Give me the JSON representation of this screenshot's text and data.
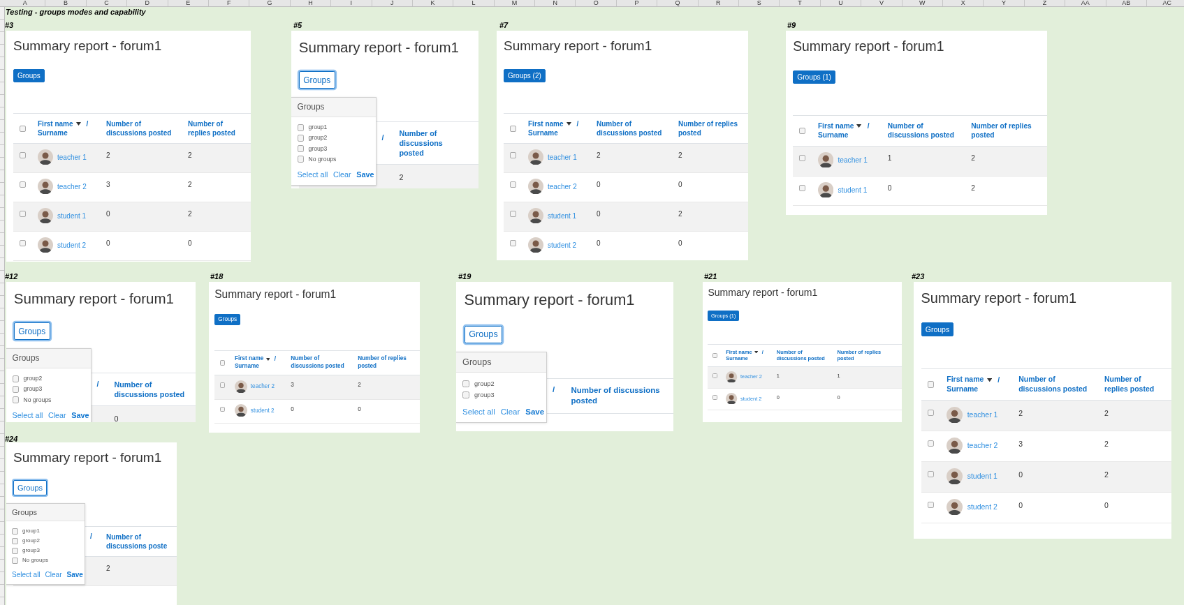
{
  "spreadsheet": {
    "column_headers": [
      "A",
      "B",
      "C",
      "D",
      "E",
      "F",
      "G",
      "H",
      "I",
      "J",
      "K",
      "L",
      "M",
      "N",
      "O",
      "P",
      "Q",
      "R",
      "S",
      "T",
      "U",
      "V",
      "W",
      "X",
      "Y",
      "Z",
      "AA",
      "AB",
      "AC"
    ],
    "title": "Testing - groups modes and capability",
    "screenshots": [
      {
        "label": "#3",
        "title": "Summary report - forum1",
        "groups_button": {
          "label": "Groups",
          "expanded": false
        },
        "table": {
          "header_checkbox": {
            "checked": false
          },
          "name_header": {
            "first": "First name",
            "separator": "/",
            "last": "Surname"
          },
          "columns": [
            "Number of discussions posted",
            "Number of replies posted"
          ],
          "rows": [
            {
              "name": "teacher 1",
              "checked": false,
              "values": [
                "2",
                "2"
              ]
            },
            {
              "name": "teacher 2",
              "checked": false,
              "values": [
                "3",
                "2"
              ]
            },
            {
              "name": "student 1",
              "checked": false,
              "values": [
                "0",
                "2"
              ]
            },
            {
              "name": "student 2",
              "checked": false,
              "values": [
                "0",
                "0"
              ]
            }
          ]
        }
      },
      {
        "label": "#5",
        "title": "Summary report - forum1",
        "groups_button": {
          "label": "Groups",
          "expanded": true
        },
        "dropdown": {
          "title": "Groups",
          "options": [
            {
              "label": "group1",
              "checked": false
            },
            {
              "label": "group2",
              "checked": false
            },
            {
              "label": "group3",
              "checked": false
            },
            {
              "label": "No groups",
              "checked": false
            }
          ],
          "actions": [
            "Select all",
            "Clear",
            "Save"
          ]
        },
        "table": {
          "name_header": {
            "separator": "/"
          },
          "columns": [
            "Number of discussions posted"
          ],
          "rows": [
            {
              "values": [
                "2"
              ]
            }
          ]
        }
      },
      {
        "label": "#7",
        "title": "Summary report - forum1",
        "groups_button": {
          "label": "Groups (2)",
          "expanded": false
        },
        "table": {
          "header_checkbox": {
            "checked": false
          },
          "name_header": {
            "first": "First name",
            "separator": "/",
            "last": "Surname"
          },
          "columns": [
            "Number of discussions posted",
            "Number of replies posted"
          ],
          "rows": [
            {
              "name": "teacher 1",
              "checked": false,
              "values": [
                "2",
                "2"
              ]
            },
            {
              "name": "teacher 2",
              "checked": false,
              "values": [
                "0",
                "0"
              ]
            },
            {
              "name": "student 1",
              "checked": false,
              "values": [
                "0",
                "2"
              ]
            },
            {
              "name": "student 2",
              "checked": false,
              "values": [
                "0",
                "0"
              ]
            }
          ]
        }
      },
      {
        "label": "#9",
        "title": "Summary report - forum1",
        "groups_button": {
          "label": "Groups (1)",
          "expanded": false
        },
        "table": {
          "header_checkbox": {
            "checked": false
          },
          "name_header": {
            "first": "First name",
            "separator": "/",
            "last": "Surname"
          },
          "columns": [
            "Number of discussions posted",
            "Number of replies posted"
          ],
          "rows": [
            {
              "name": "teacher 1",
              "checked": false,
              "values": [
                "1",
                "2"
              ]
            },
            {
              "name": "student 1",
              "checked": false,
              "values": [
                "0",
                "2"
              ]
            }
          ]
        }
      },
      {
        "label": "#12",
        "title": "Summary report - forum1",
        "groups_button": {
          "label": "Groups",
          "expanded": true
        },
        "dropdown": {
          "title": "Groups",
          "options": [
            {
              "label": "group2",
              "checked": false
            },
            {
              "label": "group3",
              "checked": false
            },
            {
              "label": "No groups",
              "checked": false
            }
          ],
          "actions": [
            "Select all",
            "Clear",
            "Save"
          ]
        },
        "table": {
          "name_header": {
            "separator": "/"
          },
          "columns": [
            "Number of discussions posted"
          ],
          "rows": [
            {
              "values": [
                "0"
              ]
            }
          ]
        }
      },
      {
        "label": "#18",
        "title": "Summary report - forum1",
        "groups_button": {
          "label": "Groups",
          "expanded": false
        },
        "table": {
          "header_checkbox": {
            "checked": false
          },
          "name_header": {
            "first": "First name",
            "separator": "/",
            "last": "Surname"
          },
          "columns": [
            "Number of discussions posted",
            "Number of replies posted"
          ],
          "rows": [
            {
              "name": "teacher 2",
              "checked": false,
              "values": [
                "3",
                "2"
              ]
            },
            {
              "name": "student 2",
              "checked": false,
              "values": [
                "0",
                "0"
              ]
            }
          ]
        }
      },
      {
        "label": "#19",
        "title": "Summary report - forum1",
        "groups_button": {
          "label": "Groups",
          "expanded": true
        },
        "dropdown": {
          "title": "Groups",
          "options": [
            {
              "label": "group2",
              "checked": false
            },
            {
              "label": "group3",
              "checked": false
            }
          ],
          "actions": [
            "Select all",
            "Clear",
            "Save"
          ]
        },
        "table": {
          "name_header": {
            "separator": "/"
          },
          "columns": [
            "Number of discussions posted"
          ]
        }
      },
      {
        "label": "#21",
        "title": "Summary report - forum1",
        "groups_button": {
          "label": "Groups (1)",
          "expanded": false
        },
        "table": {
          "header_checkbox": {
            "checked": false
          },
          "name_header": {
            "first": "First name",
            "separator": "/",
            "last": "Surname"
          },
          "columns": [
            "Number of discussions posted",
            "Number of replies posted"
          ],
          "rows": [
            {
              "name": "teacher 2",
              "checked": false,
              "values": [
                "1",
                "1"
              ]
            },
            {
              "name": "student 2",
              "checked": false,
              "values": [
                "0",
                "0"
              ]
            }
          ]
        }
      },
      {
        "label": "#23",
        "title": "Summary report - forum1",
        "groups_button": {
          "label": "Groups",
          "expanded": false
        },
        "table": {
          "header_checkbox": {
            "checked": false
          },
          "name_header": {
            "first": "First name",
            "separator": "/",
            "last": "Surname"
          },
          "columns": [
            "Number of discussions posted",
            "Number of replies posted"
          ],
          "rows": [
            {
              "name": "teacher 1",
              "checked": false,
              "values": [
                "2",
                "2"
              ]
            },
            {
              "name": "teacher 2",
              "checked": false,
              "values": [
                "3",
                "2"
              ]
            },
            {
              "name": "student 1",
              "checked": false,
              "values": [
                "0",
                "2"
              ]
            },
            {
              "name": "student 2",
              "checked": false,
              "values": [
                "0",
                "0"
              ]
            }
          ]
        }
      },
      {
        "label": "#24",
        "title": "Summary report - forum1",
        "groups_button": {
          "label": "Groups",
          "expanded": true
        },
        "dropdown": {
          "title": "Groups",
          "options": [
            {
              "label": "group1",
              "checked": false
            },
            {
              "label": "group2",
              "checked": false
            },
            {
              "label": "group3",
              "checked": false
            },
            {
              "label": "No groups",
              "checked": false
            }
          ],
          "actions": [
            "Select all",
            "Clear",
            "Save"
          ]
        },
        "table": {
          "name_header": {
            "separator": "/"
          },
          "columns": [
            "Number of discussions poste"
          ],
          "rows": [
            {
              "values": [
                "2"
              ]
            }
          ]
        }
      }
    ]
  }
}
